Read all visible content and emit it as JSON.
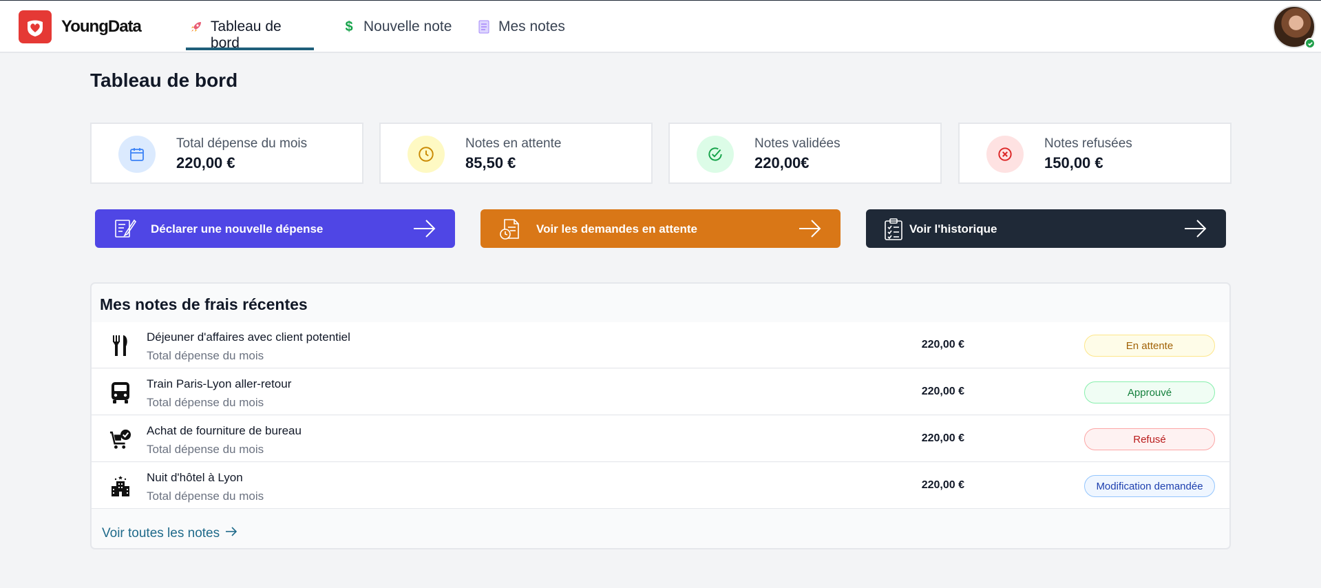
{
  "header": {
    "brand": "YoungData",
    "nav": [
      {
        "label": "Tableau de bord",
        "icon": "rocket-icon",
        "active": true
      },
      {
        "label": "Nouvelle note",
        "icon": "dollar-icon",
        "active": false
      },
      {
        "label": "Mes notes",
        "icon": "document-icon",
        "active": false
      }
    ]
  },
  "page_title": "Tableau de bord",
  "stats": [
    {
      "label": "Total dépense du mois",
      "value": "220,00 €",
      "icon": "calendar-icon",
      "color": "#3b82f6"
    },
    {
      "label": "Notes en attente",
      "value": "85,50 €",
      "icon": "clock-icon",
      "color": "#ca8a04"
    },
    {
      "label": "Notes validées",
      "value": "220,00€",
      "icon": "check-circle-icon",
      "color": "#16a34a"
    },
    {
      "label": "Notes refusées",
      "value": "150,00 €",
      "icon": "x-circle-icon",
      "color": "#dc2626"
    }
  ],
  "actions": [
    {
      "label": "Déclarer une nouvelle dépense",
      "icon": "note-pen-icon",
      "color": "#4f46e5"
    },
    {
      "label": "Voir les demandes en attente",
      "icon": "document-clock-icon",
      "color": "#d97717"
    },
    {
      "label": "Voir l'historique",
      "icon": "clipboard-list-icon",
      "color": "#1f2937"
    }
  ],
  "recent": {
    "title": "Mes notes de frais récentes",
    "rows": [
      {
        "title": "Déjeuner d'affaires avec client potentiel",
        "subtitle": "Total dépense du mois",
        "amount": "220,00 €",
        "status": "En attente",
        "icon": "utensils-icon"
      },
      {
        "title": "Train Paris-Lyon aller-retour",
        "subtitle": "Total dépense du mois",
        "amount": "220,00 €",
        "status": "Approuvé",
        "icon": "train-icon"
      },
      {
        "title": "Achat de fourniture de bureau",
        "subtitle": "Total dépense du mois",
        "amount": "220,00 €",
        "status": "Refusé",
        "icon": "cart-check-icon"
      },
      {
        "title": "Nuit d'hôtel à Lyon",
        "subtitle": "Total dépense du mois",
        "amount": "220,00 €",
        "status": "Modification demandée",
        "icon": "hotel-icon"
      }
    ],
    "see_all": "Voir toutes les notes"
  },
  "status_colors": {
    "pending": {
      "bg": "#fefce8",
      "border": "#fde68a",
      "text": "#a16207"
    },
    "approved": {
      "bg": "#f0fdf4",
      "border": "#86efac",
      "text": "#15803d"
    },
    "refused": {
      "bg": "#fef2f2",
      "border": "#fca5a5",
      "text": "#b91c1c"
    },
    "modification": {
      "bg": "#eff6ff",
      "border": "#93c5fd",
      "text": "#1e40af"
    }
  }
}
